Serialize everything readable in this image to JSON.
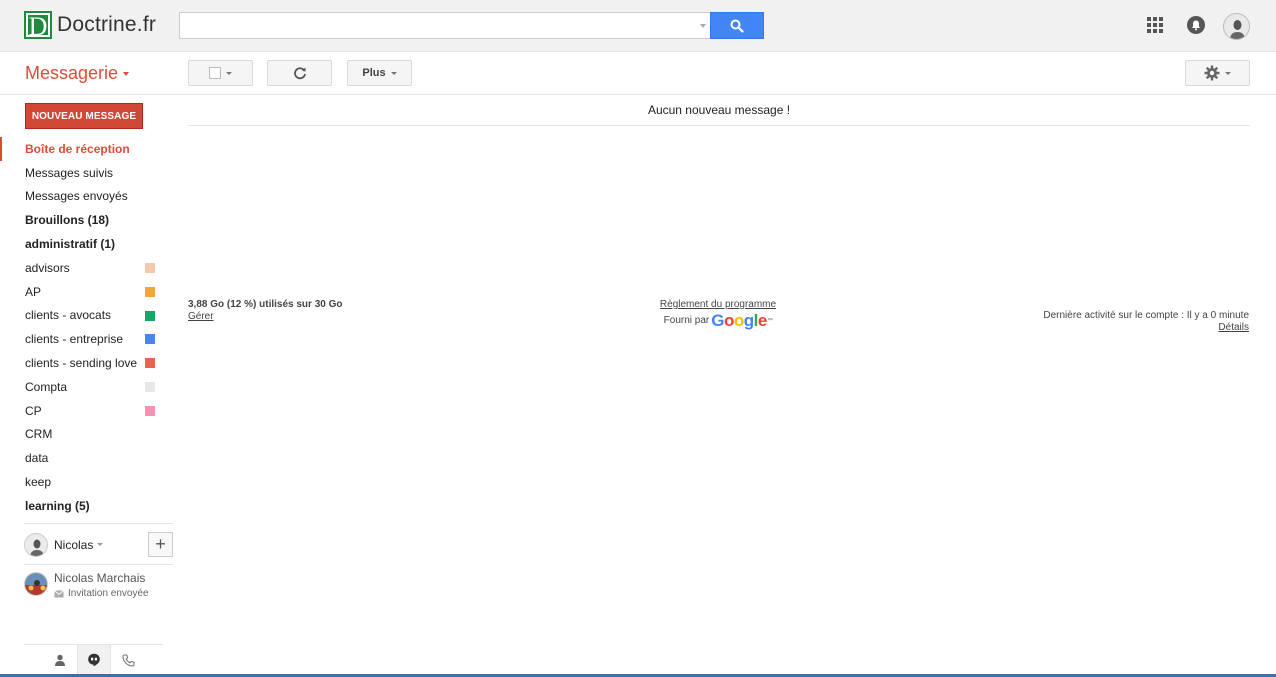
{
  "header": {
    "logo_letter": "D",
    "logo_text": "Doctrine.fr",
    "search_value": "",
    "search_placeholder": ""
  },
  "toolbar": {
    "app_title": "Messagerie",
    "more_label": "Plus"
  },
  "sidebar": {
    "compose_label": "NOUVEAU MESSAGE",
    "folders": [
      {
        "label": "Boîte de réception",
        "style": "active",
        "color": null
      },
      {
        "label": "Messages suivis",
        "style": "normal",
        "color": null
      },
      {
        "label": "Messages envoyés",
        "style": "normal",
        "color": null
      },
      {
        "label": "Brouillons (18)",
        "style": "bold",
        "color": null
      },
      {
        "label": "administratif (1)",
        "style": "bold",
        "color": null
      },
      {
        "label": "advisors",
        "style": "normal",
        "color": "#f8c8ae"
      },
      {
        "label": "AP",
        "style": "normal",
        "color": "#f4a541"
      },
      {
        "label": "clients - avocats",
        "style": "normal",
        "color": "#16a765"
      },
      {
        "label": "clients - entreprise",
        "style": "normal",
        "color": "#4a86e8"
      },
      {
        "label": "clients - sending love",
        "style": "normal",
        "color": "#e66550"
      },
      {
        "label": "Compta",
        "style": "normal",
        "color": "#e7e7e7"
      },
      {
        "label": "CP",
        "style": "normal",
        "color": "#f691b2"
      },
      {
        "label": "CRM",
        "style": "normal",
        "color": null
      },
      {
        "label": "data",
        "style": "normal",
        "color": null
      },
      {
        "label": "keep",
        "style": "normal",
        "color": null
      },
      {
        "label": "learning (5)",
        "style": "bold",
        "color": null
      }
    ],
    "chat": {
      "self_name": "Nicolas",
      "add_label": "+",
      "contact_name": "Nicolas Marchais",
      "contact_status": "Invitation envoyée"
    }
  },
  "main": {
    "no_messages": "Aucun nouveau message !",
    "usage": "3,88 Go (12 %) utilisés sur 30 Go",
    "manage_link": "Gérer",
    "program_policy": "Règlement du programme",
    "powered_by": "Fourni par",
    "last_activity": "Dernière activité sur le compte : Il y a 0 minute",
    "details_link": "Détails"
  },
  "colors": {
    "accent_red": "#dd4b39",
    "compose_red": "#d14836",
    "search_blue": "#4285f4",
    "logo_green": "#1d8a3c"
  },
  "icons": [
    "search-icon",
    "apps-icon",
    "notifications-icon",
    "refresh-icon",
    "settings-icon",
    "person-icon",
    "hangouts-icon",
    "phone-icon",
    "envelope-icon"
  ]
}
